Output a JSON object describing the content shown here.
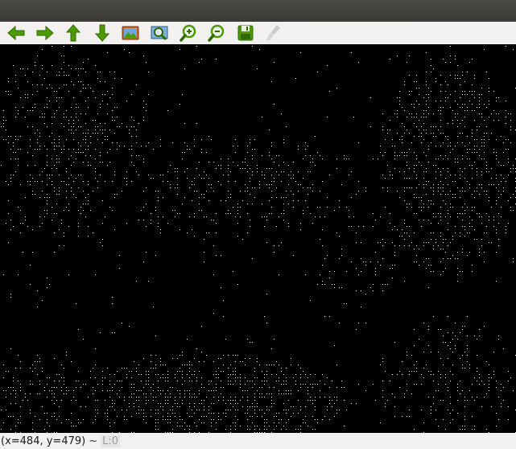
{
  "toolbar": {
    "buttons": [
      {
        "name": "back-button",
        "icon": "arrow-left-icon",
        "disabled": false
      },
      {
        "name": "forward-button",
        "icon": "arrow-right-icon",
        "disabled": false
      },
      {
        "name": "up-button",
        "icon": "arrow-up-icon",
        "disabled": false
      },
      {
        "name": "down-button",
        "icon": "arrow-down-icon",
        "disabled": false
      },
      {
        "name": "image-button",
        "icon": "image-icon",
        "disabled": false
      },
      {
        "name": "zoom-fit-button",
        "icon": "zoom-fit-icon",
        "disabled": false
      },
      {
        "name": "zoom-in-button",
        "icon": "zoom-in-icon",
        "disabled": false
      },
      {
        "name": "zoom-out-button",
        "icon": "zoom-out-icon",
        "disabled": false
      },
      {
        "name": "save-button",
        "icon": "save-icon",
        "disabled": false
      },
      {
        "name": "clear-button",
        "icon": "brush-icon",
        "disabled": true
      }
    ]
  },
  "status": {
    "coords": "(x=484, y=479)",
    "separator": "~",
    "level": "L:0"
  },
  "colors": {
    "icon_green": "#4e9a06",
    "canvas_bg": "#000000",
    "title_bg": "#3c3b37"
  }
}
